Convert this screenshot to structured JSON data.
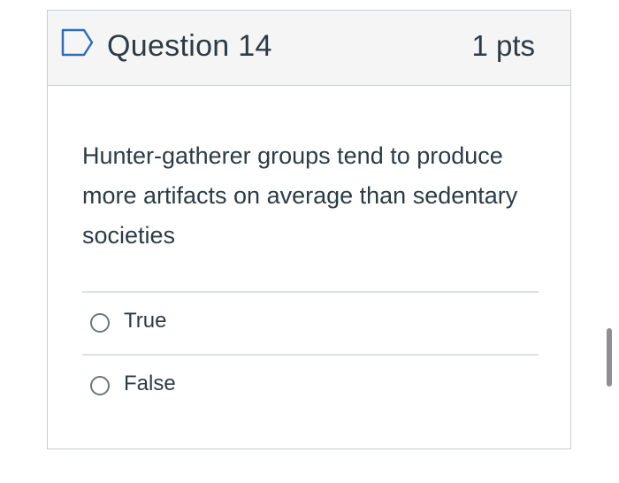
{
  "question": {
    "title": "Question 14",
    "points": "1 pts",
    "flag_icon": "bookmark-flag-outline",
    "accent_color": "#2d3b45",
    "text": "Hunter-gatherer groups tend to produce more artifacts on average than sedentary societies"
  },
  "answers": [
    {
      "label": "True",
      "selected": false
    },
    {
      "label": "False",
      "selected": false
    }
  ]
}
